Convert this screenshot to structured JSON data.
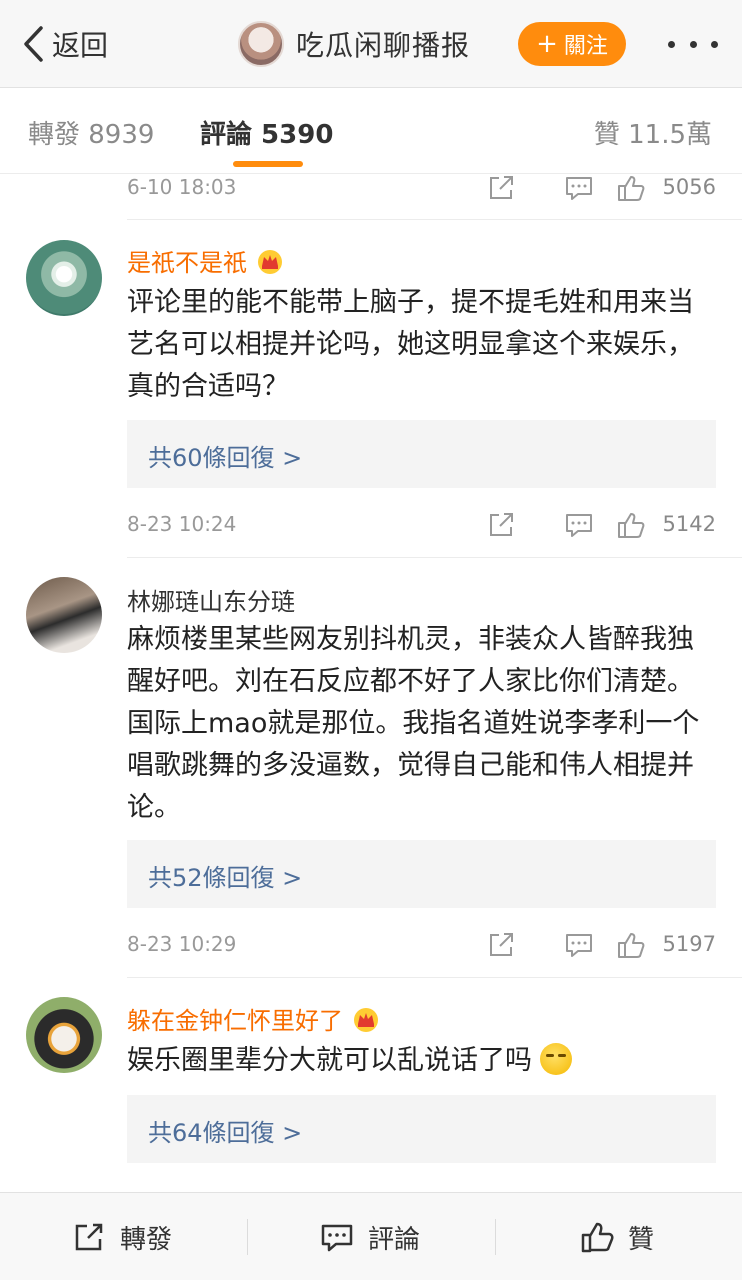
{
  "nav": {
    "back_label": "返回",
    "title": "吃瓜闲聊播报",
    "follow_label": "關注",
    "follow_plus": "+"
  },
  "tabs": {
    "repost": "轉發 8939",
    "comment": "評論 5390",
    "like": "贊 11.5萬"
  },
  "colors": {
    "accent": "#ff8c0d",
    "vip_name": "#f86d00",
    "reply_link": "#4d6d99"
  },
  "top_meta": {
    "time": "6-10 18:03",
    "likes": "5056"
  },
  "comments": [
    {
      "name": "是祇不是祇",
      "vip": true,
      "text": "评论里的能不能带上脑子，提不提毛姓和用来当艺名可以相提并论吗，她这明显拿这个来娱乐，真的合适吗？",
      "replies": "共60條回復 >",
      "time": "8-23 10:24",
      "likes": "5142"
    },
    {
      "name": "林娜琏山东分琏",
      "vip": false,
      "text": "麻烦楼里某些网友别抖机灵，非装众人皆醉我独醒好吧。刘在石反应都不好了人家比你们清楚。国际上mao就是那位。我指名道姓说李孝利一个唱歌跳舞的多没逼数，觉得自己能和伟人相提并论。",
      "replies": "共52條回復 >",
      "time": "8-23 10:29",
      "likes": "5197"
    },
    {
      "name": "躲在金钟仁怀里好了",
      "vip": true,
      "text": "娱乐圈里辈分大就可以乱说话了吗",
      "emoji": "smirk-emoji",
      "replies": "共64條回復 >"
    }
  ],
  "bottom": {
    "repost": "轉發",
    "comment": "評論",
    "like": "贊"
  }
}
